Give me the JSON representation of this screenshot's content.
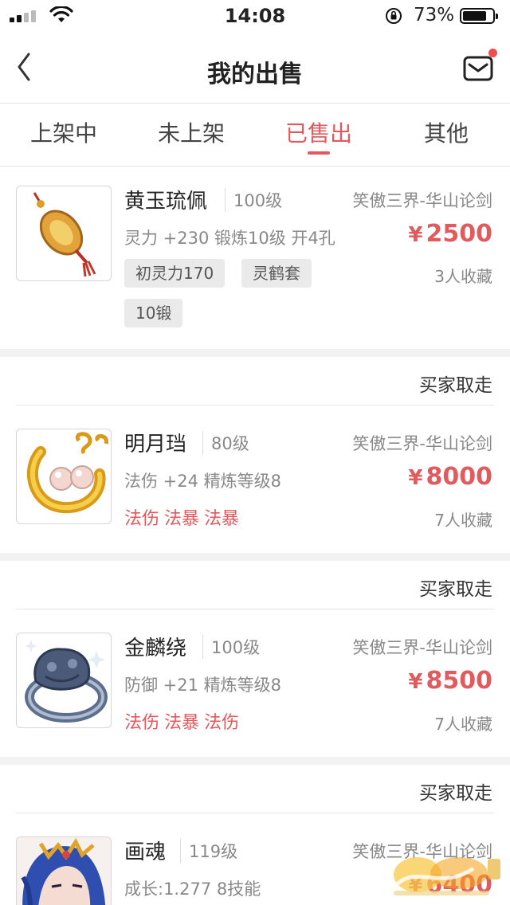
{
  "status_bar": {
    "time": "14:08",
    "battery_percent": "73%",
    "battery_level": 0.73
  },
  "nav": {
    "title": "我的出售",
    "back_icon": "chevron-left-icon",
    "mail_icon": "mail-icon",
    "has_unread": true
  },
  "tabs": [
    {
      "label": "上架中",
      "active": false
    },
    {
      "label": "未上架",
      "active": false
    },
    {
      "label": "已售出",
      "active": true
    },
    {
      "label": "其他",
      "active": false
    }
  ],
  "items": [
    {
      "name": "黄玉琉佩",
      "level": "100级",
      "server": "笑傲三界-华山论剑",
      "stats": "灵力 +230 锻炼10级 开4孔",
      "currency": "¥",
      "price": "2500",
      "favorites": "3人收藏",
      "tags": [
        "初灵力170",
        "灵鹤套",
        "10锻"
      ],
      "image_icon": "jade-pendant-icon"
    },
    {
      "buyer_status": "买家取走",
      "name": "明月珰",
      "level": "80级",
      "server": "笑傲三界-华山论剑",
      "stats": "法伤 +24 精炼等级8",
      "currency": "¥",
      "price": "8000",
      "favorites": "7人收藏",
      "attributes": [
        "法伤",
        "法暴",
        "法暴"
      ],
      "image_icon": "pearl-earring-icon"
    },
    {
      "buyer_status": "买家取走",
      "name": "金麟绕",
      "level": "100级",
      "server": "笑傲三界-华山论剑",
      "stats": "防御 +21 精炼等级8",
      "currency": "¥",
      "price": "8500",
      "favorites": "7人收藏",
      "attributes": [
        "法伤",
        "法暴",
        "法伤"
      ],
      "image_icon": "qilin-ring-icon"
    },
    {
      "buyer_status": "买家取走",
      "name": "画魂",
      "level": "119级",
      "server": "笑傲三界-华山论剑",
      "stats": "成长:1.277 8技能",
      "currency": "¥",
      "price": "6400",
      "image_icon": "character-portrait-icon"
    }
  ],
  "colors": {
    "accent": "#e05a5e",
    "text": "#222222",
    "muted": "#888888",
    "chip_bg": "#eaeaea",
    "separator": "#f2f2f2"
  },
  "watermark_icon": "site-watermark-logo"
}
